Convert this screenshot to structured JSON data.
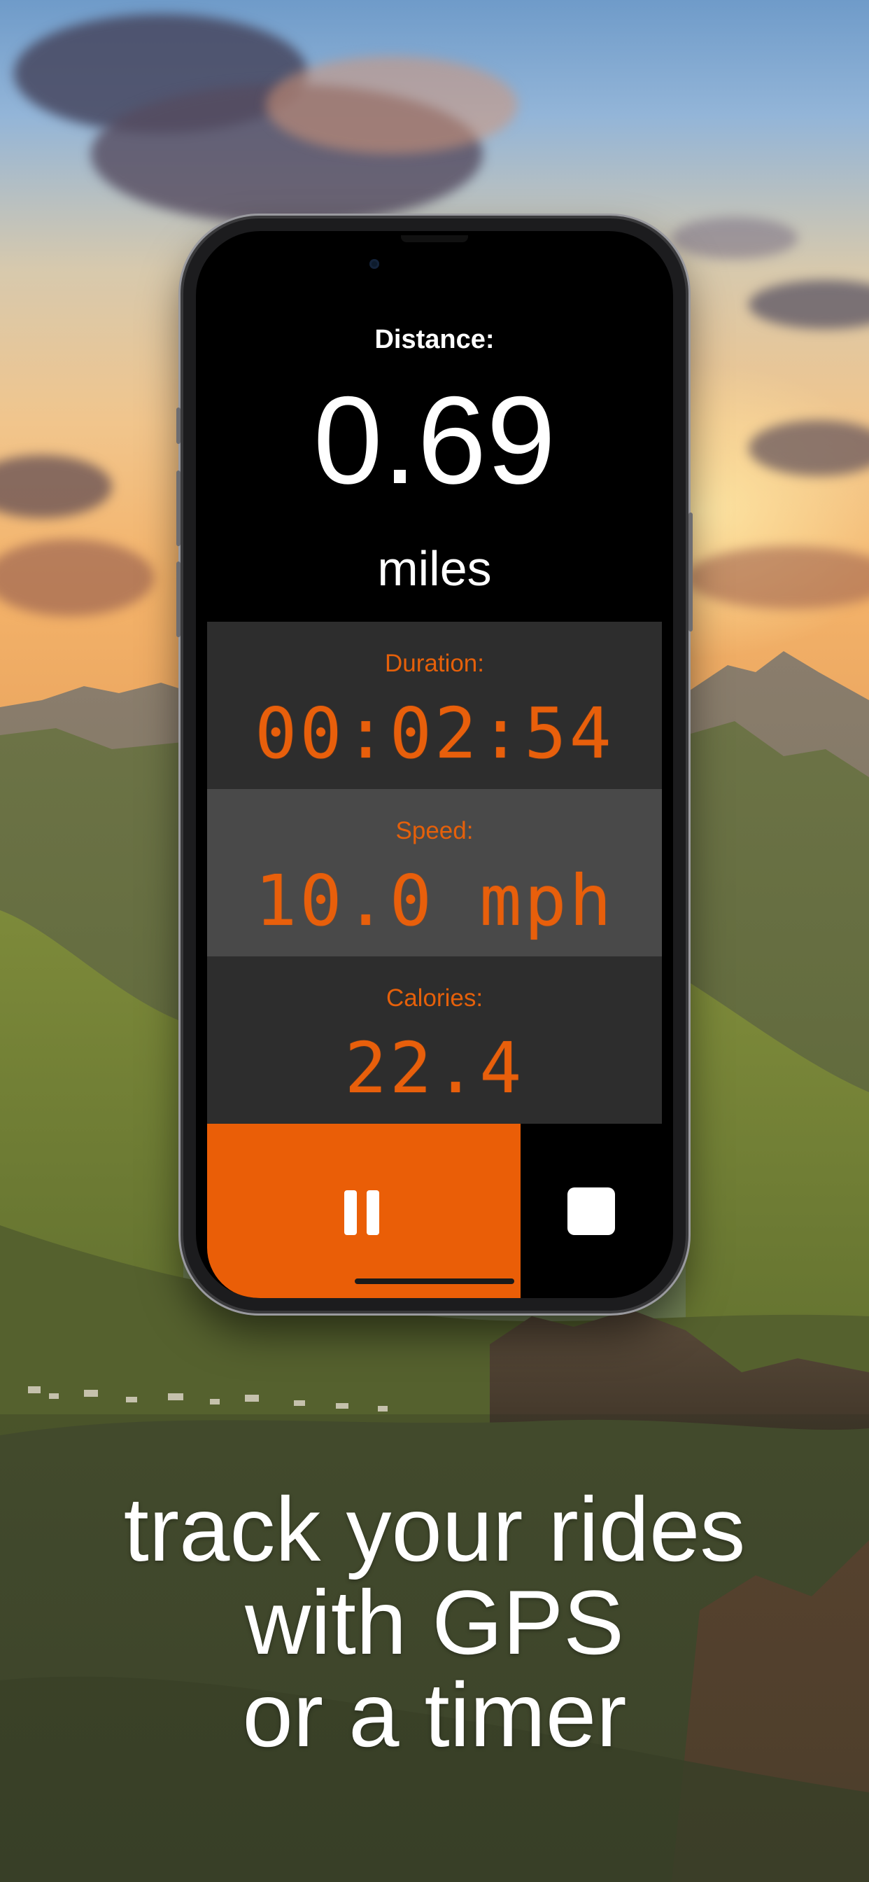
{
  "tracker": {
    "distance_label": "Distance:",
    "distance_value": "0.69",
    "distance_unit": "miles",
    "stats": [
      {
        "label": "Duration:",
        "value": "00:02:54"
      },
      {
        "label": "Speed:",
        "value": "10.0 mph"
      },
      {
        "label": "Calories:",
        "value": "22.4"
      }
    ],
    "controls": {
      "pause_icon": "pause-icon",
      "stop_icon": "stop-icon"
    }
  },
  "caption": {
    "lines": [
      "track your rides",
      "with GPS",
      "or a timer"
    ]
  },
  "colors": {
    "accent": "#ea5e07",
    "stat_dark": "#2d2d2d",
    "stat_light": "#494949",
    "screen": "#000000"
  }
}
